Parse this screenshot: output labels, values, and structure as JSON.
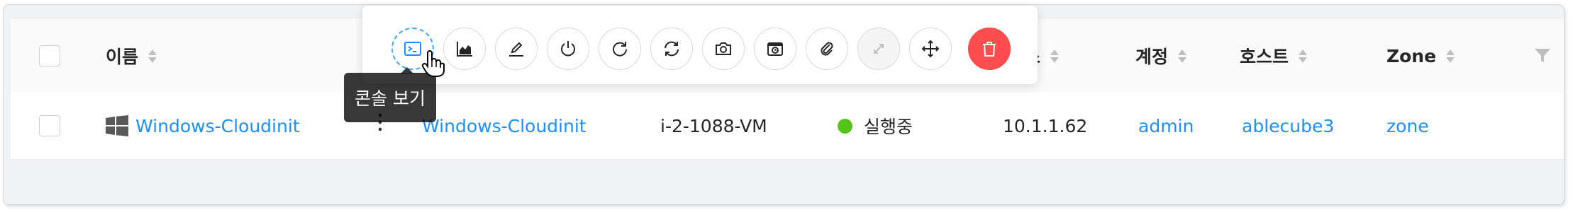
{
  "table": {
    "headers": {
      "name": "이름",
      "address_fragment": "소",
      "account": "계정",
      "host": "호스트",
      "zone": "Zone"
    },
    "row": {
      "name": "Windows-Cloudinit",
      "display_name": "Windows-Cloudinit",
      "instance_name": "i-2-1088-VM",
      "status": "실행중",
      "ip_address": "10.1.1.62",
      "account": "admin",
      "host": "ablecube3",
      "zone": "zone"
    }
  },
  "toolbar": {
    "actions": [
      {
        "name": "console",
        "icon": "terminal-icon",
        "state": "hover"
      },
      {
        "name": "metrics",
        "icon": "area-chart-icon"
      },
      {
        "name": "edit",
        "icon": "edit-icon"
      },
      {
        "name": "stop",
        "icon": "power-icon"
      },
      {
        "name": "reboot",
        "icon": "reload-icon"
      },
      {
        "name": "reinstall",
        "icon": "sync-icon"
      },
      {
        "name": "snapshot",
        "icon": "camera-icon"
      },
      {
        "name": "vm-snapshot",
        "icon": "camera-schedule-icon"
      },
      {
        "name": "attach-iso",
        "icon": "paperclip-icon"
      },
      {
        "name": "scale",
        "icon": "arrows-alt-icon",
        "state": "disabled"
      },
      {
        "name": "migrate",
        "icon": "drag-icon"
      },
      {
        "name": "destroy",
        "icon": "delete-icon",
        "state": "danger"
      }
    ]
  },
  "tooltip": {
    "text": "콘솔 보기"
  },
  "colors": {
    "link": "#1890ff",
    "running": "#52c41a",
    "danger": "#ff4d4f",
    "active_border": "#40a9ff"
  }
}
